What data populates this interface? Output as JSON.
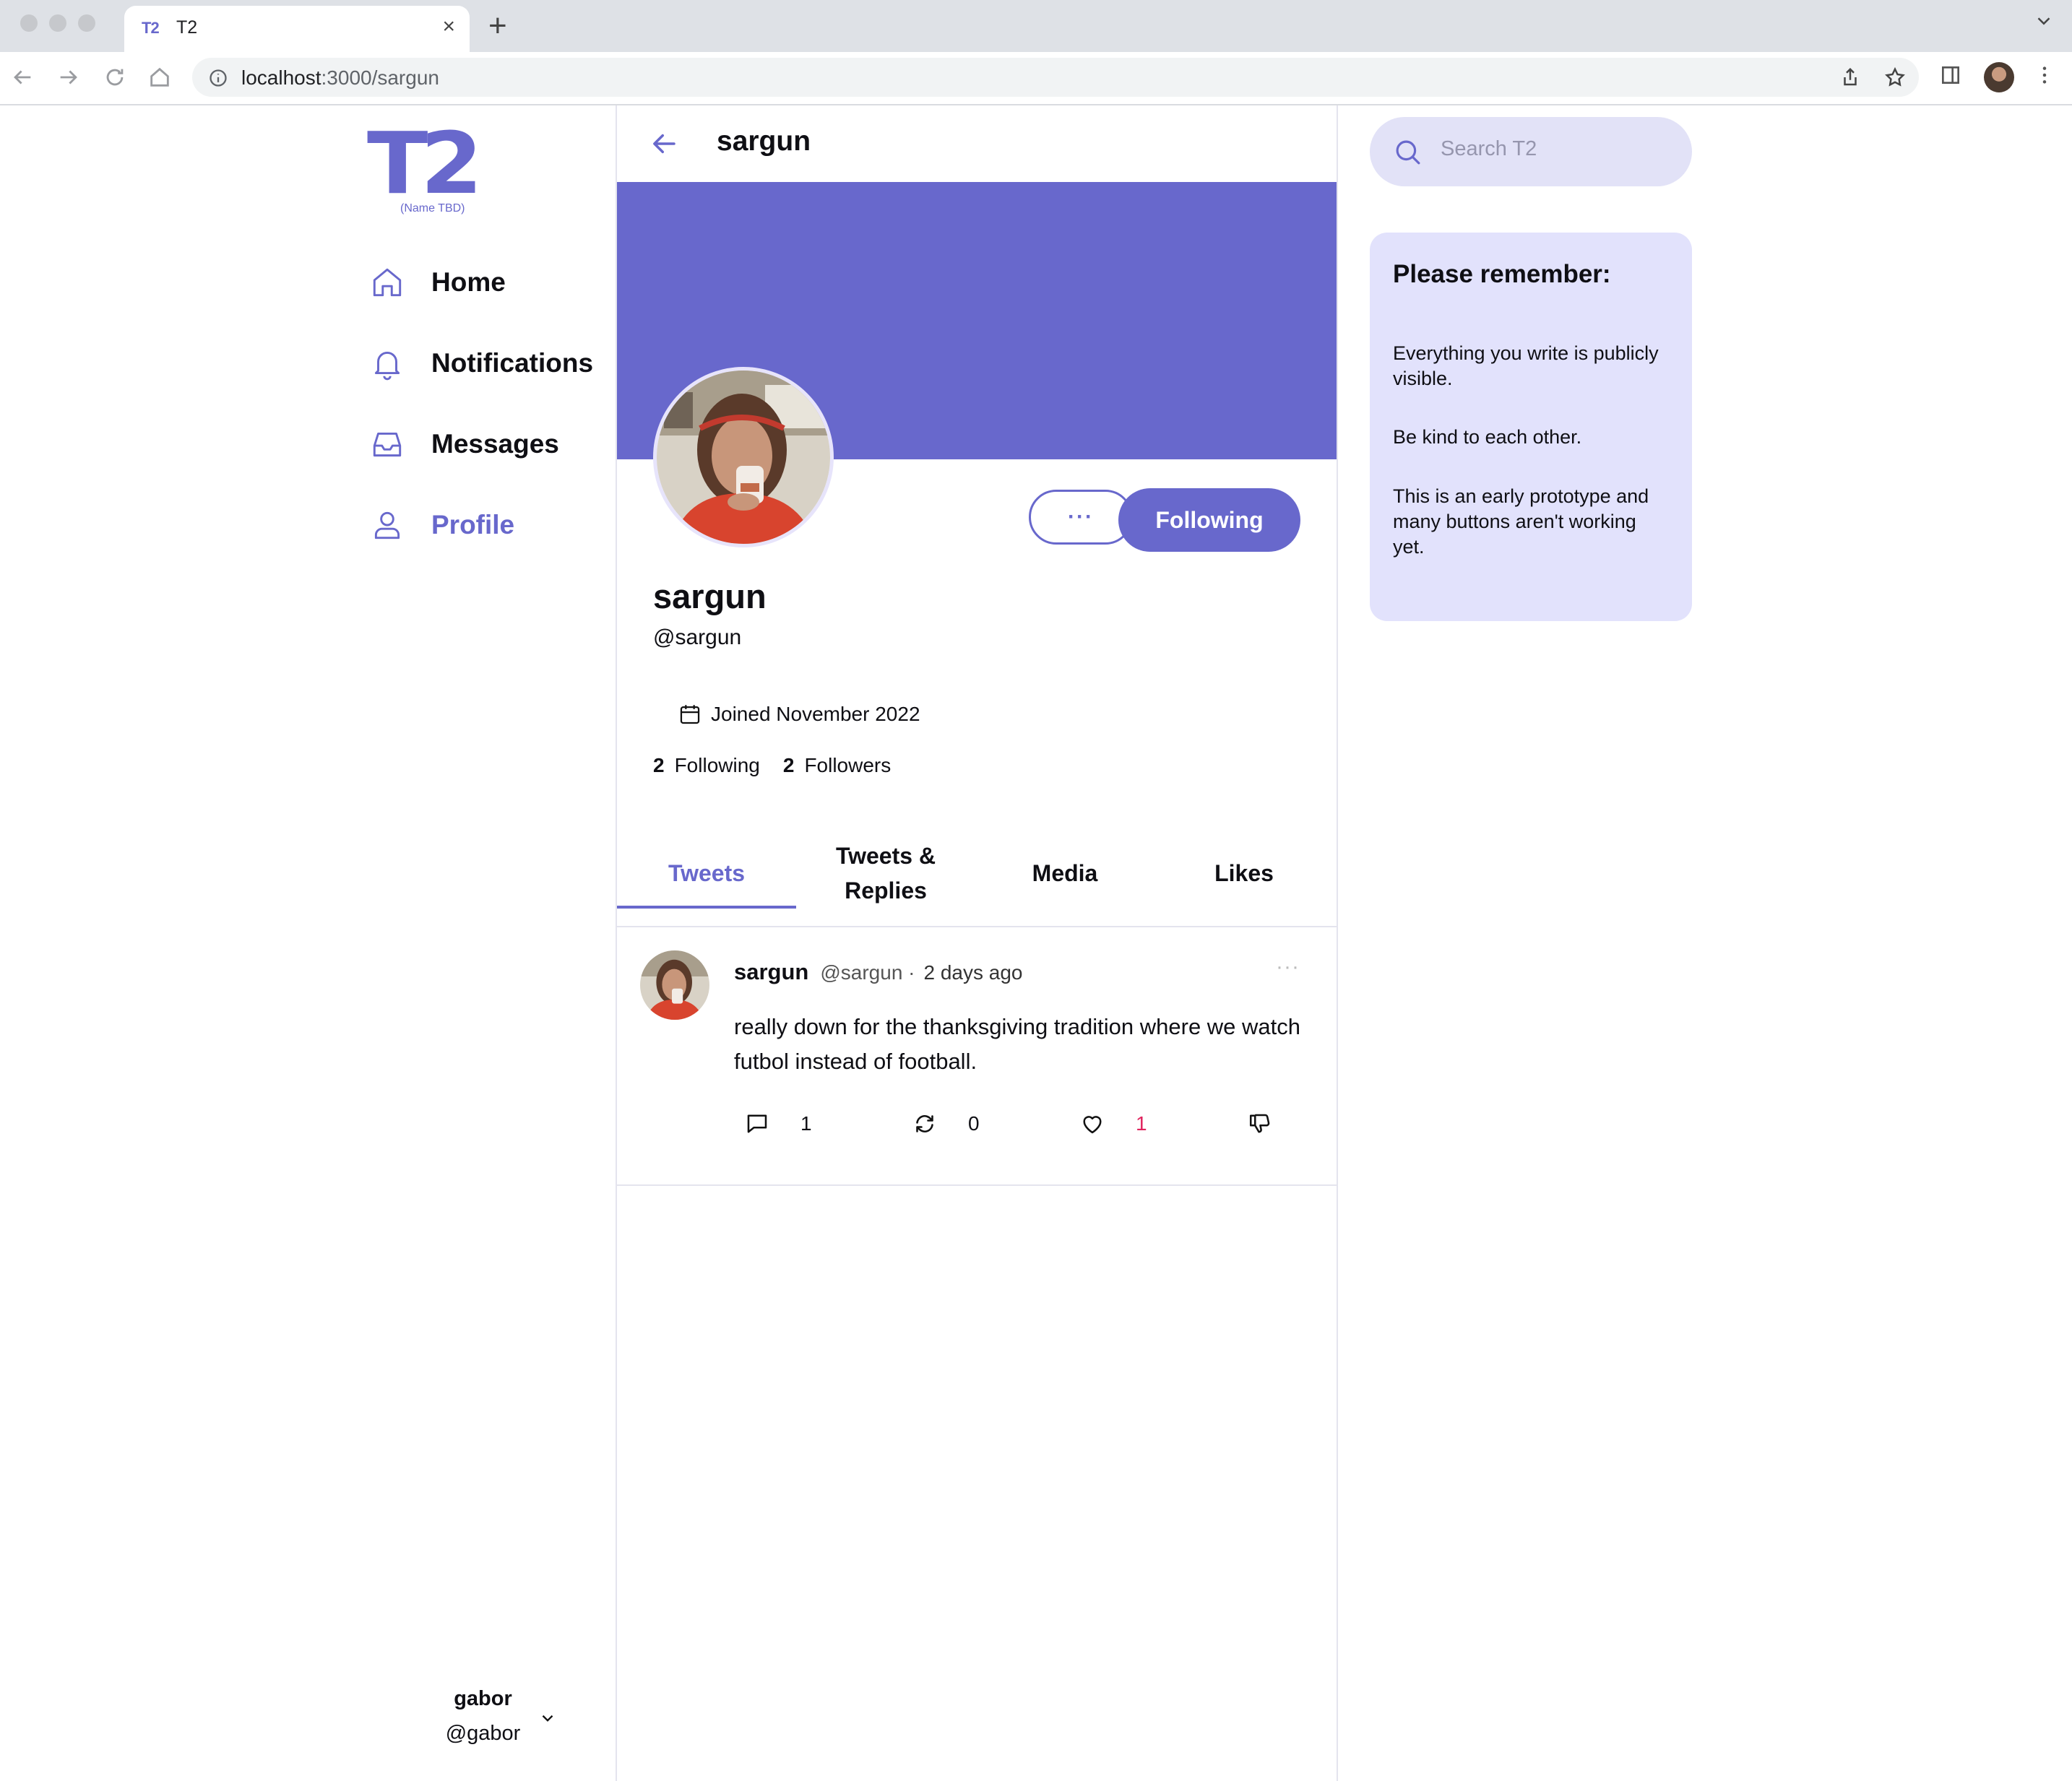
{
  "browser": {
    "tab_title": "T2",
    "tab_favicon": "T2",
    "url_host": "localhost",
    "url_path": ":3000/sargun"
  },
  "sidebar": {
    "logo_text": "T2",
    "logo_subtitle": "(Name TBD)",
    "nav": [
      {
        "label": "Home",
        "icon": "home-icon"
      },
      {
        "label": "Notifications",
        "icon": "bell-icon"
      },
      {
        "label": "Messages",
        "icon": "inbox-icon"
      },
      {
        "label": "Profile",
        "icon": "user-icon",
        "active": true
      }
    ],
    "account": {
      "name": "gabor",
      "handle": "@gabor"
    }
  },
  "profile": {
    "header_title": "sargun",
    "display_name": "sargun",
    "handle": "@sargun",
    "joined": "Joined November 2022",
    "following_count": "2",
    "following_label": "Following",
    "followers_count": "2",
    "followers_label": "Followers",
    "more_label": "···",
    "follow_button_label": "Following",
    "tabs": [
      "Tweets",
      "Tweets & Replies",
      "Media",
      "Likes"
    ],
    "active_tab": "Tweets",
    "accent_color": "#6868cc"
  },
  "tweets": [
    {
      "name": "sargun",
      "handle": "@sargun ·",
      "time": "2 days ago",
      "text": "really down for the thanksgiving tradition where we watch futbol instead of football.",
      "replies": "1",
      "retweets": "0",
      "likes": "1"
    }
  ],
  "right": {
    "search_placeholder": "Search T2",
    "notice_title": "Please remember:",
    "notice_lines": [
      "Everything you write is publicly visible.",
      "Be kind to each other.",
      "This is an early prototype and many buttons aren't working yet."
    ]
  }
}
